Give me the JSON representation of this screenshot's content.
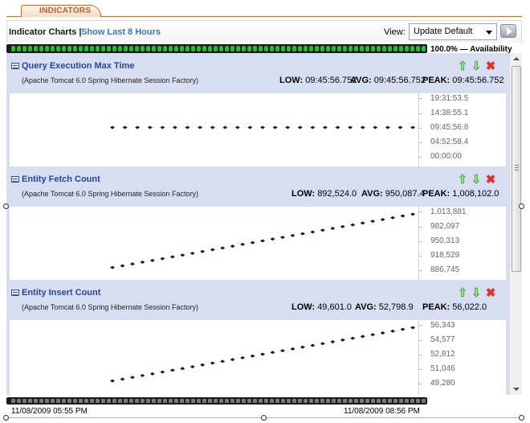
{
  "tab": {
    "label": "INDICATORS"
  },
  "header": {
    "title": "Indicator Charts |",
    "last_link": "Show Last 8 Hours",
    "view_label": "View:",
    "view_selected": "Update Default"
  },
  "availability": {
    "text": "100.0% — Availability",
    "fraction": 1.0
  },
  "timeline": {
    "start": "11/08/2009 05:55 PM",
    "end": "11/08/2009 08:56 PM"
  },
  "panels": [
    {
      "name": "Query Execution Max Time",
      "source": "(Apache Tomcat 6.0 Spring Hibernate Session Factory)",
      "low_label": "LOW:",
      "low": "09:45:56.752",
      "avg_label": "AVG:",
      "avg": "09:45:56.752",
      "peak_label": "PEAK:",
      "peak": "09:45:56.752",
      "ticks": [
        "19:31:53.5",
        "14:38:55.1",
        "09:45:56.8",
        "04:52:58.4",
        "00:00:00"
      ]
    },
    {
      "name": "Entity Fetch Count",
      "source": "(Apache Tomcat 6.0 Spring Hibernate Session Factory)",
      "low_label": "LOW:",
      "low": "892,524.0",
      "avg_label": "AVG:",
      "avg": "950,087.4",
      "peak_label": "PEAK:",
      "peak": "1,008,102.0",
      "ticks": [
        "1,013,881",
        "982,097",
        "950,313",
        "918,529",
        "886,745"
      ]
    },
    {
      "name": "Entity Insert Count",
      "source": "(Apache Tomcat 6.0 Spring Hibernate Session Factory)",
      "low_label": "LOW:",
      "low": "49,601.0",
      "avg_label": "AVG:",
      "avg": "52,798.9",
      "peak_label": "PEAK:",
      "peak": "56,022.0",
      "ticks": [
        "56,343",
        "54,577",
        "52,812",
        "51,046",
        "49,280"
      ]
    }
  ],
  "series": [
    {
      "points": 25,
      "start": 9.766,
      "end": 9.766,
      "min": 0,
      "max": 19.5315
    },
    {
      "points": 31,
      "start": 892524.0,
      "end": 1008102.0,
      "min": 886745,
      "max": 1013881
    },
    {
      "points": 31,
      "start": 49601.0,
      "end": 56022.0,
      "min": 49280,
      "max": 56343
    }
  ],
  "colors": {
    "accent": "#2345a8",
    "link": "#3a78c4",
    "availability": "#22c02a",
    "point": "#101060",
    "panel_bg": "#d8def1"
  },
  "icons": [
    "chart-icon",
    "arrow-up-icon",
    "arrow-down-icon",
    "close-icon",
    "go-icon"
  ]
}
